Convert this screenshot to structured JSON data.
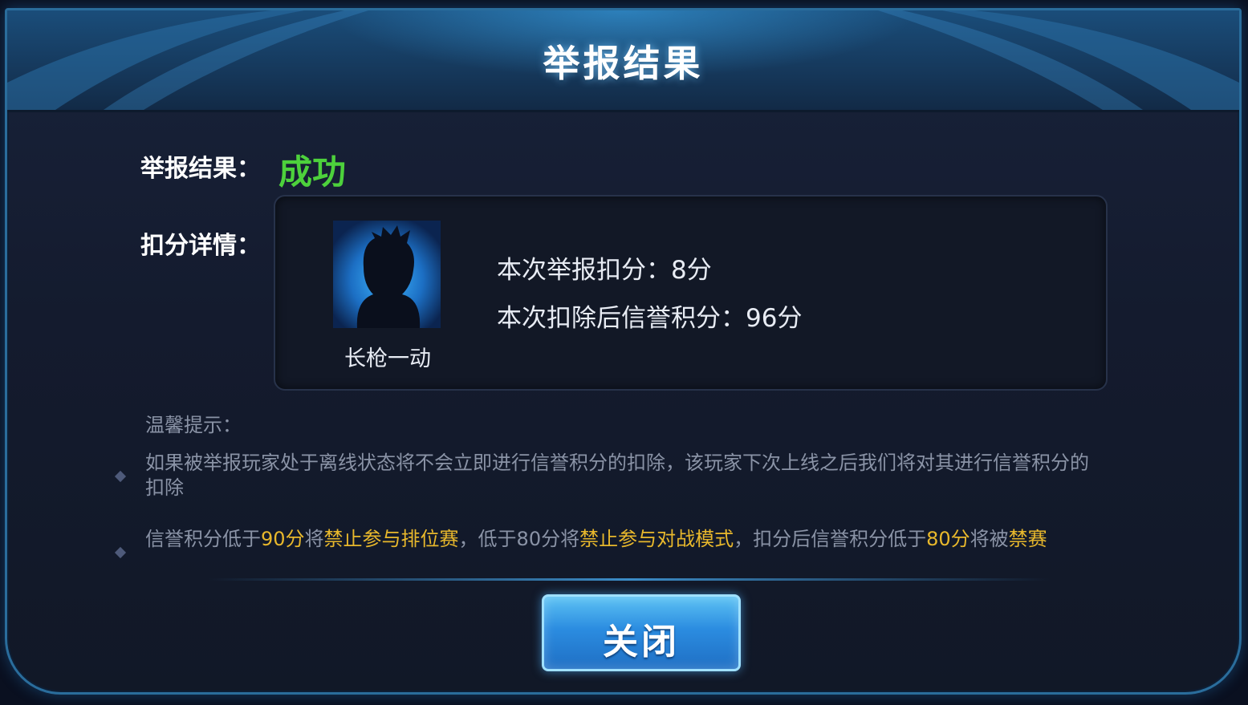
{
  "dialog": {
    "title": "举报结果"
  },
  "result": {
    "label": "举报结果：",
    "value": "成功"
  },
  "details": {
    "label": "扣分详情：",
    "player_name": "长枪一动",
    "deduction_text": "本次举报扣分：8分",
    "credit_after_text": "本次扣除后信誉积分：96分"
  },
  "tips": {
    "title": "温馨提示：",
    "tip1": "如果被举报玩家处于离线状态将不会立即进行信誉积分的扣除，该玩家下次上线之后我们将对其进行信誉积分的扣除",
    "tip2_parts": {
      "a": "信誉积分低于",
      "b": "90分",
      "c": "将",
      "d": "禁止参与排位赛",
      "e": "，低于80分将",
      "f": "禁止参与对战模式",
      "g": "，扣分后信誉积分低于",
      "h": "80分",
      "i": "将被",
      "j": "禁赛"
    }
  },
  "buttons": {
    "close": "关闭"
  },
  "colors": {
    "success": "#4dd13c",
    "highlight": "#e8b82c",
    "accent": "#2b8ce0"
  },
  "icons": {
    "avatar": "silhouette-avatar-icon",
    "bullet": "diamond-bullet-icon"
  }
}
